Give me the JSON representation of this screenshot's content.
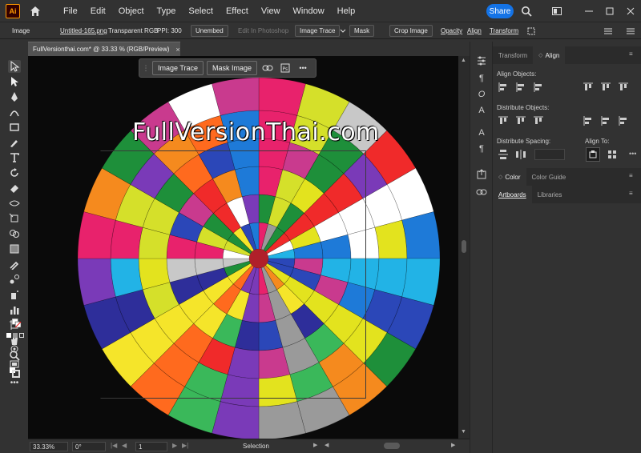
{
  "app": {
    "logo": "Ai",
    "menu": [
      "File",
      "Edit",
      "Object",
      "Type",
      "Select",
      "Effect",
      "View",
      "Window",
      "Help"
    ],
    "share_label": "Share"
  },
  "control_bar": {
    "object_type": "Image",
    "file_name": "Untitled-165.png",
    "color_mode": "Transparent RGB",
    "ppi": "PPI: 300",
    "unembed": "Unembed",
    "edit_in_photoshop": "Edit In Photoshop",
    "image_trace": "Image Trace",
    "mask": "Mask",
    "crop_image": "Crop Image",
    "opacity": "Opacity",
    "align": "Align",
    "transform": "Transform"
  },
  "document": {
    "tab_title": "FullVersionthai.com* @ 33.33 % (RGB/Preview)",
    "watermark": "FullVersionThai.com"
  },
  "task_bar": {
    "image_trace": "Image Trace",
    "mask_image": "Mask Image",
    "more": "•••"
  },
  "status_bar": {
    "zoom": "33.33%",
    "rotation": "0°",
    "artboard": "1",
    "tool": "Selection"
  },
  "panels": {
    "top_tabs": [
      "Transform",
      "Align"
    ],
    "align_objects": "Align Objects:",
    "distribute_objects": "Distribute Objects:",
    "distribute_spacing": "Distribute Spacing:",
    "align_to": "Align To:",
    "color_tabs": [
      "Color",
      "Color Guide"
    ],
    "artboard_tabs": [
      "Artboards",
      "Libraries"
    ]
  },
  "colors": {
    "accent": "#1473e6",
    "ai_brand": "#ff9a00"
  }
}
